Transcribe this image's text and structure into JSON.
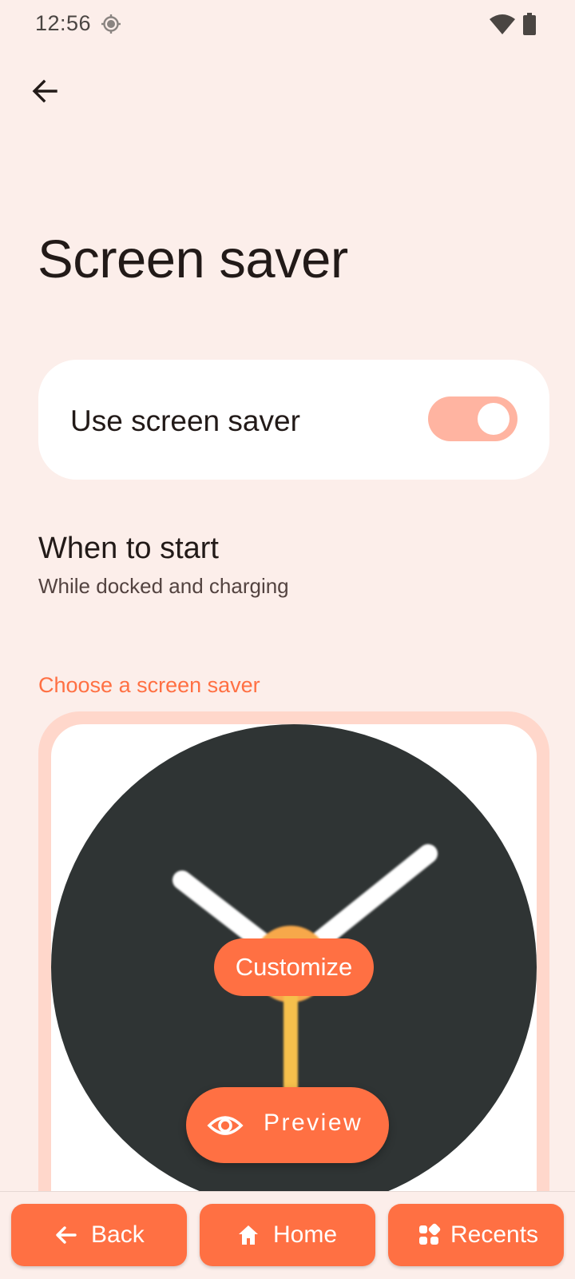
{
  "status_bar": {
    "time": "12:56"
  },
  "header": {
    "title": "Screen saver"
  },
  "toggle": {
    "label": "Use screen saver",
    "checked": true
  },
  "when_to_start": {
    "title": "When to start",
    "subtitle": "While docked and charging"
  },
  "section": {
    "label": "Choose a screen saver"
  },
  "saver": {
    "customize_label": "Customize",
    "preview_label": "Preview"
  },
  "nav": {
    "back_label": "Back",
    "home_label": "Home",
    "recents_label": "Recents"
  },
  "colors": {
    "background": "#FCEEEA",
    "accent": "#FF7043",
    "switch_track": "#FFB4A1",
    "card_frame": "#FFD7CB",
    "clock_face": "#2F3434",
    "clock_center": "#F7A84A",
    "clock_second_hand": "#F6C04C"
  }
}
